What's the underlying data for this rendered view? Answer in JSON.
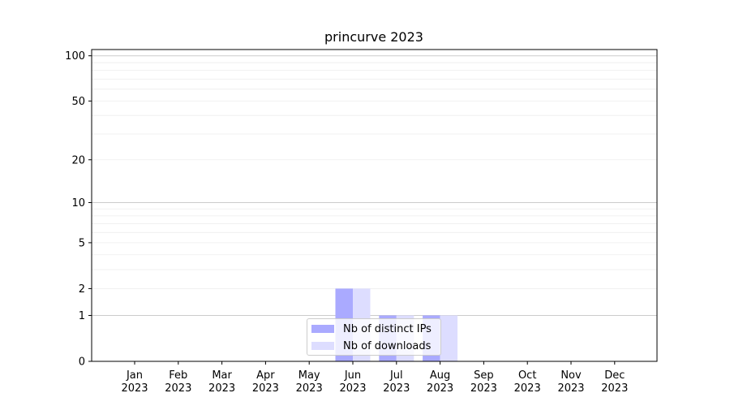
{
  "colors": {
    "ips": "#aaaaff",
    "downloads": "#ddddff",
    "major_grid": "#cccccc",
    "minor_grid": "#eeeeee"
  },
  "legend": {
    "placement": "lower center",
    "items": [
      {
        "label": "Nb of distinct IPs",
        "color": "#aaaaff"
      },
      {
        "label": "Nb of downloads",
        "color": "#ddddff"
      }
    ]
  },
  "chart_data": {
    "type": "bar",
    "title": "princurve 2023",
    "xlabel": "",
    "ylabel": "",
    "yscale": "symlog",
    "ylim": [
      0,
      110
    ],
    "yticks": [
      0,
      1,
      2,
      5,
      10,
      20,
      50,
      100
    ],
    "grid": true,
    "categories": [
      "Jan\n2023",
      "Feb\n2023",
      "Mar\n2023",
      "Apr\n2023",
      "May\n2023",
      "Jun\n2023",
      "Jul\n2023",
      "Aug\n2023",
      "Sep\n2023",
      "Oct\n2023",
      "Nov\n2023",
      "Dec\n2023"
    ],
    "series": [
      {
        "name": "Nb of distinct IPs",
        "values": [
          0,
          0,
          0,
          0,
          0,
          2,
          1,
          1,
          0,
          0,
          0,
          0
        ]
      },
      {
        "name": "Nb of downloads",
        "values": [
          0,
          0,
          0,
          0,
          0,
          2,
          1,
          1,
          0,
          0,
          0,
          0
        ]
      }
    ]
  }
}
